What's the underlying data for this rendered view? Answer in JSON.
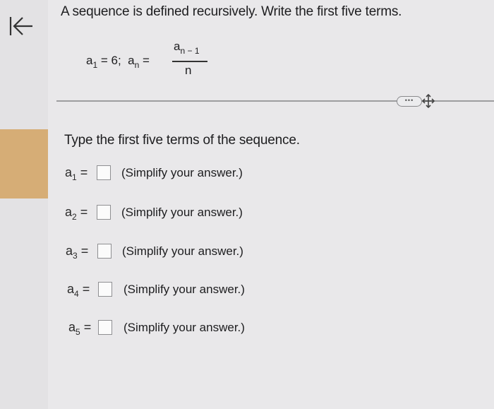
{
  "nav": {
    "back_icon": "arrow-left-to-bar-icon"
  },
  "question": {
    "prompt": "A sequence is defined recursively. Write the first five terms.",
    "formula": {
      "a1_var": "a",
      "a1_sub": "1",
      "a1_rest": " = 6;  ",
      "an_var": "a",
      "an_sub": "n",
      "an_eq": " =",
      "num_var": "a",
      "num_sub": "n − 1",
      "den": "n"
    }
  },
  "toolbar": {
    "more_label": "•••",
    "drag_icon": "move-arrows-icon"
  },
  "answer": {
    "instructions": "Type the first five terms of the sequence.",
    "terms": [
      {
        "var": "a",
        "sub": "1",
        "eq": " =",
        "value": "",
        "hint": "(Simplify your answer.)"
      },
      {
        "var": "a",
        "sub": "2",
        "eq": " =",
        "value": "",
        "hint": "(Simplify your answer.)"
      },
      {
        "var": "a",
        "sub": "3",
        "eq": " =",
        "value": "",
        "hint": "(Simplify your answer.)"
      },
      {
        "var": "a",
        "sub": "4",
        "eq": " =",
        "value": "",
        "hint": "(Simplify your answer.)"
      },
      {
        "var": "a",
        "sub": "5",
        "eq": " =",
        "value": "",
        "hint": "(Simplify your answer.)"
      }
    ]
  },
  "colors": {
    "background": "#e9e8ea",
    "sidebar_highlight": "#d6ad76",
    "text": "#1d1d1f"
  }
}
